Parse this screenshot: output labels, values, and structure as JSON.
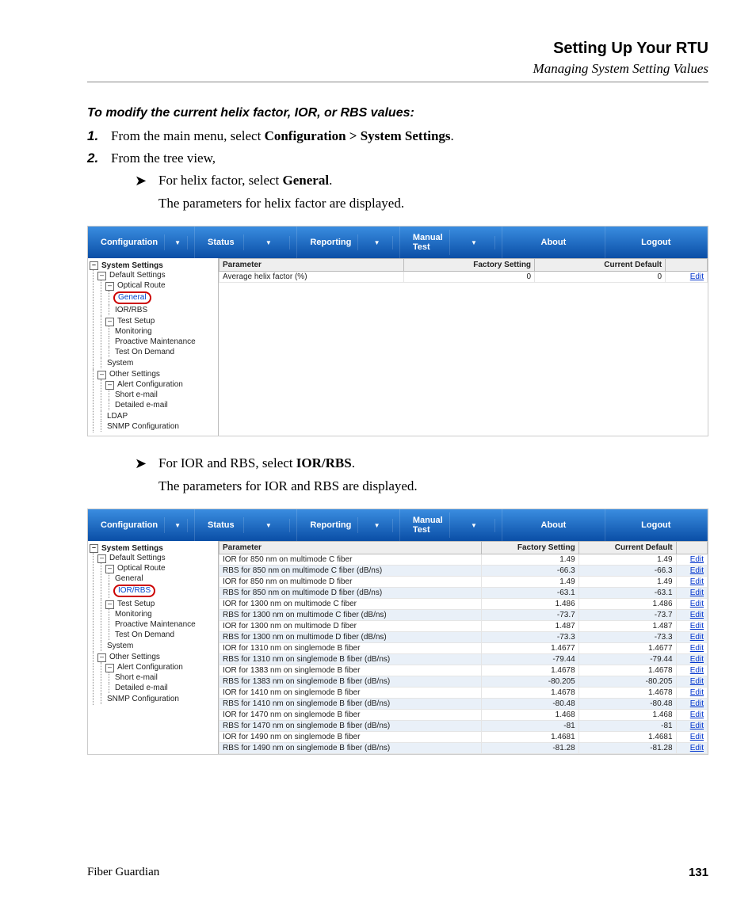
{
  "header": {
    "title": "Setting Up Your RTU",
    "subtitle": "Managing System Setting Values"
  },
  "intro": "To modify the current helix factor, IOR, or RBS values:",
  "steps": [
    {
      "num": "1.",
      "pre": "From the main menu, select ",
      "bold": "Configuration > System Settings",
      "post": "."
    },
    {
      "num": "2.",
      "pre": "From the tree view,",
      "bold": "",
      "post": ""
    }
  ],
  "subs": [
    {
      "pre": "For helix factor, select ",
      "bold": "General",
      "post": ".",
      "result": "The parameters for helix factor are displayed."
    },
    {
      "pre": "For IOR and RBS, select ",
      "bold": "IOR/RBS",
      "post": ".",
      "result": "The parameters for IOR and RBS are displayed."
    }
  ],
  "menu": [
    "Configuration",
    "Status",
    "Reporting",
    "Manual Test",
    "About",
    "Logout"
  ],
  "tree": {
    "root": "System Settings",
    "n1": "Default Settings",
    "n2": "Optical Route",
    "n3": "General",
    "n4": "IOR/RBS",
    "n5": "Test Setup",
    "n6": "Monitoring",
    "n7": "Proactive Maintenance",
    "n8": "Test On Demand",
    "n9": "System",
    "n10": "Other Settings",
    "n11": "Alert Configuration",
    "n12": "Short e-mail",
    "n13": "Detailed e-mail",
    "n14": "LDAP",
    "n15": "SNMP Configuration"
  },
  "table1": {
    "cols": [
      "Parameter",
      "Factory Setting",
      "Current Default",
      ""
    ],
    "rows": [
      [
        "Average helix factor (%)",
        "0",
        "0",
        "Edit"
      ]
    ]
  },
  "table2": {
    "cols": [
      "Parameter",
      "Factory Setting",
      "Current Default",
      ""
    ],
    "rows": [
      [
        "IOR for 850 nm on multimode C fiber",
        "1.49",
        "1.49",
        "Edit"
      ],
      [
        "RBS for 850 nm on multimode C fiber (dB/ns)",
        "-66.3",
        "-66.3",
        "Edit"
      ],
      [
        "IOR for 850 nm on multimode D fiber",
        "1.49",
        "1.49",
        "Edit"
      ],
      [
        "RBS for 850 nm on multimode D fiber (dB/ns)",
        "-63.1",
        "-63.1",
        "Edit"
      ],
      [
        "IOR for 1300 nm on multimode C fiber",
        "1.486",
        "1.486",
        "Edit"
      ],
      [
        "RBS for 1300 nm on multimode C fiber (dB/ns)",
        "-73.7",
        "-73.7",
        "Edit"
      ],
      [
        "IOR for 1300 nm on multimode D fiber",
        "1.487",
        "1.487",
        "Edit"
      ],
      [
        "RBS for 1300 nm on multimode D fiber (dB/ns)",
        "-73.3",
        "-73.3",
        "Edit"
      ],
      [
        "IOR for 1310 nm on singlemode B fiber",
        "1.4677",
        "1.4677",
        "Edit"
      ],
      [
        "RBS for 1310 nm on singlemode B fiber (dB/ns)",
        "-79.44",
        "-79.44",
        "Edit"
      ],
      [
        "IOR for 1383 nm on singlemode B fiber",
        "1.4678",
        "1.4678",
        "Edit"
      ],
      [
        "RBS for 1383 nm on singlemode B fiber (dB/ns)",
        "-80.205",
        "-80.205",
        "Edit"
      ],
      [
        "IOR for 1410 nm on singlemode B fiber",
        "1.4678",
        "1.4678",
        "Edit"
      ],
      [
        "RBS for 1410 nm on singlemode B fiber (dB/ns)",
        "-80.48",
        "-80.48",
        "Edit"
      ],
      [
        "IOR for 1470 nm on singlemode B fiber",
        "1.468",
        "1.468",
        "Edit"
      ],
      [
        "RBS for 1470 nm on singlemode B fiber (dB/ns)",
        "-81",
        "-81",
        "Edit"
      ],
      [
        "IOR for 1490 nm on singlemode B fiber",
        "1.4681",
        "1.4681",
        "Edit"
      ],
      [
        "RBS for 1490 nm on singlemode B fiber (dB/ns)",
        "-81.28",
        "-81.28",
        "Edit"
      ]
    ]
  },
  "footer": {
    "product": "Fiber Guardian",
    "page": "131"
  }
}
